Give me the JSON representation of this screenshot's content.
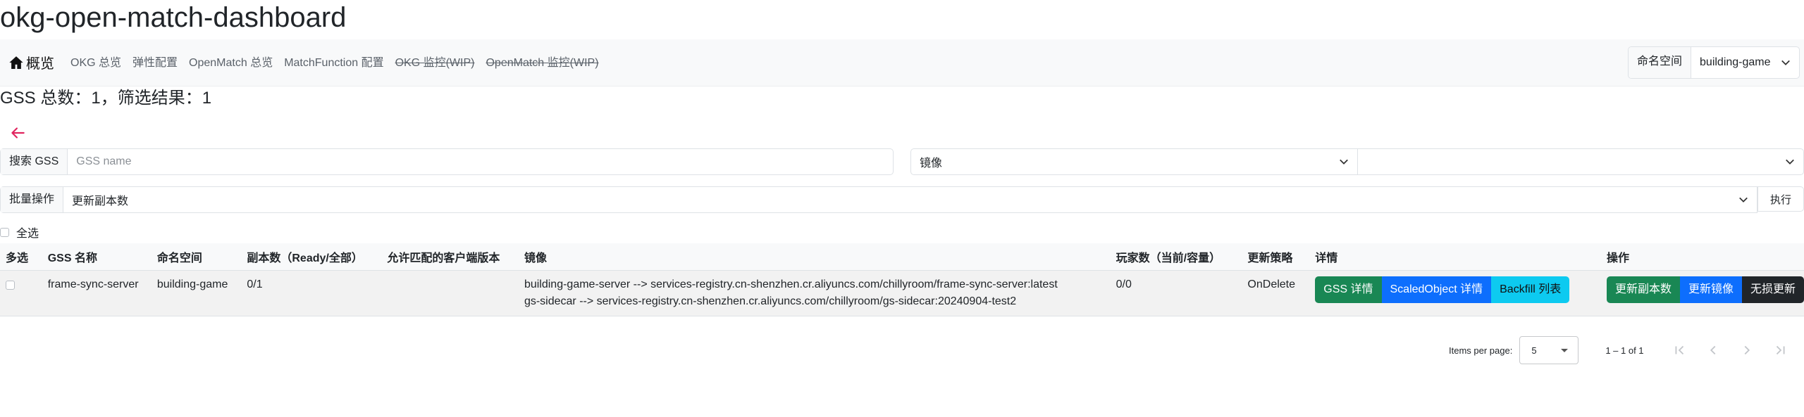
{
  "page_title": "okg-open-match-dashboard",
  "nav": {
    "home_label": "概览",
    "links": [
      "OKG 总览",
      "弹性配置",
      "OpenMatch 总览",
      "MatchFunction 配置",
      "OKG 监控(WIP)",
      "OpenMatch 监控(WIP)"
    ],
    "namespace_label": "命名空间",
    "namespace_value": "building-game"
  },
  "summary": "GSS 总数：1，筛选结果：1",
  "search": {
    "label": "搜索 GSS",
    "placeholder": "GSS name",
    "image_select": "镜像",
    "image_filter_value": ""
  },
  "batch": {
    "label": "批量操作",
    "action": "更新副本数",
    "execute": "执行"
  },
  "select_all": "全选",
  "table": {
    "headers": [
      "多选",
      "GSS 名称",
      "命名空间",
      "副本数（Ready/全部）",
      "允许匹配的客户端版本",
      "镜像",
      "玩家数（当前/容量）",
      "更新策略",
      "详情",
      "操作"
    ],
    "rows": [
      {
        "name": "frame-sync-server",
        "namespace": "building-game",
        "replicas": "0/1",
        "client_versions": "",
        "image_line1": "building-game-server --> services-registry.cn-shenzhen.cr.aliyuncs.com/chillyroom/frame-sync-server:latest",
        "image_line2": "gs-sidecar --> services-registry.cn-shenzhen.cr.aliyuncs.com/chillyroom/gs-sidecar:20240904-test2",
        "players": "0/0",
        "strategy": "OnDelete",
        "detail_buttons": [
          "GSS 详情",
          "ScaledObject 详情",
          "Backfill 列表"
        ],
        "action_buttons": [
          "更新副本数",
          "更新镜像",
          "无损更新"
        ]
      }
    ]
  },
  "paginator": {
    "items_per_page_label": "Items per page:",
    "page_size": "5",
    "range": "1 – 1 of 1"
  },
  "colors": {
    "success": "#198754",
    "primary": "#0d6efd",
    "info": "#0dcaf0",
    "dark": "#212529",
    "back_arrow": "#e0245e"
  }
}
